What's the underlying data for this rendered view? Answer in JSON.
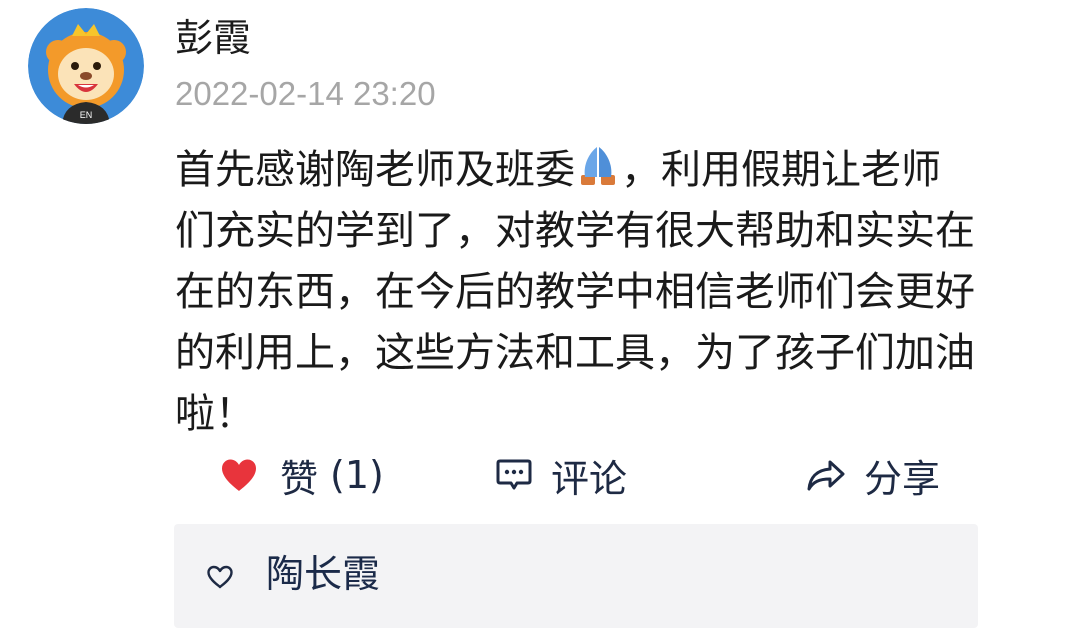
{
  "post": {
    "author": "彭霞",
    "timestamp": "2022-02-14 23:20",
    "content_lines": [
      "首先感谢陶老师及班委",
      "，利用假期让老师",
      "们充实的学到了，对教学有很大帮助和实实在",
      "在的东西，在今后的教学中相信老师们会更好",
      "的利用上，这些方法和工具，为了孩子们加油",
      "啦！"
    ],
    "emoji": "folded-hands",
    "avatar_badge": "EN"
  },
  "actions": {
    "like_label": "赞",
    "like_count": "(1)",
    "comment_label": "评论",
    "share_label": "分享"
  },
  "likes": {
    "users": [
      "陶长霞"
    ]
  },
  "colors": {
    "heart": "#e8343c",
    "action_text": "#1e2a44",
    "timestamp": "#a6a6a6",
    "panel_bg": "#f3f3f5",
    "avatar_bg": "#3d8bd8",
    "lion_mane": "#f39a2a"
  }
}
